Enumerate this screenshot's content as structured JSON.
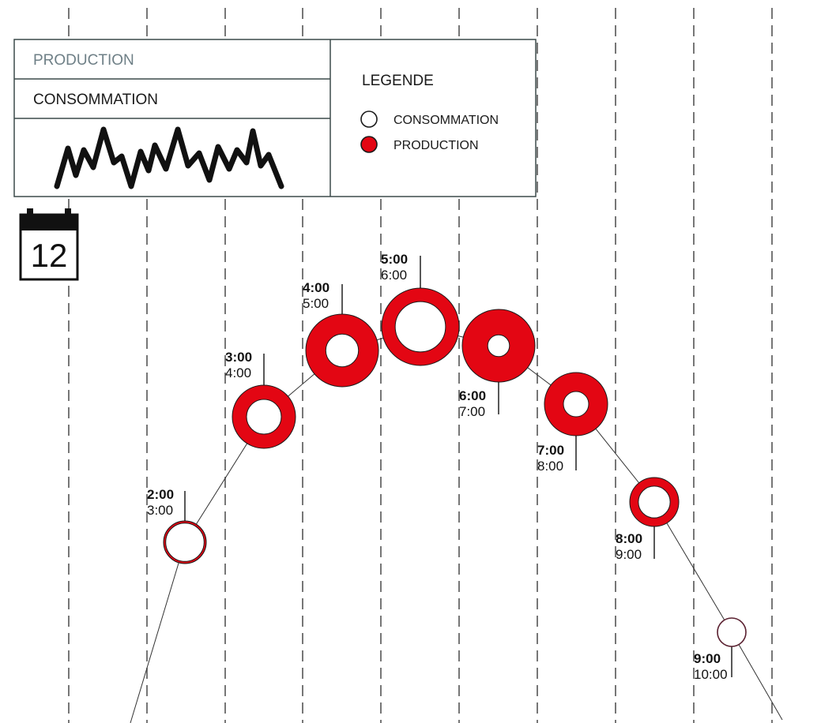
{
  "header": {
    "tab_production": "PRODUCTION",
    "tab_consommation": "CONSOMMATION"
  },
  "legend": {
    "title": "LEGENDE",
    "items": [
      {
        "label": "CONSOMMATION",
        "style": "outline"
      },
      {
        "label": "PRODUCTION",
        "style": "filled"
      }
    ]
  },
  "calendar": {
    "day": "12",
    "icon": "calendar-icon"
  },
  "colors": {
    "production": "#e30613",
    "outline": "#1a1a1a",
    "last_point": "#5a2030",
    "grid": "#555555"
  },
  "chart_data": {
    "type": "scatter",
    "title": "",
    "xlabel": "",
    "ylabel": "",
    "description_note_free": true,
    "grid": true,
    "points": [
      {
        "label_bold": "2:00",
        "label": "3:00",
        "production": 0.1,
        "consommation": 1.0
      },
      {
        "label_bold": "3:00",
        "label": "4:00",
        "production": 0.45,
        "consommation": 1.0
      },
      {
        "label_bold": "4:00",
        "label": "5:00",
        "production": 0.55,
        "consommation": 1.0
      },
      {
        "label_bold": "5:00",
        "label": "6:00",
        "production": 0.35,
        "consommation": 1.0
      },
      {
        "label_bold": "6:00",
        "label": "7:00",
        "production": 0.7,
        "consommation": 1.0
      },
      {
        "label_bold": "7:00",
        "label": "8:00",
        "production": 0.6,
        "consommation": 1.0
      },
      {
        "label_bold": "8:00",
        "label": "9:00",
        "production": 0.35,
        "consommation": 1.0
      },
      {
        "label_bold": "9:00",
        "label": "10:00",
        "production": 0.02,
        "consommation": 1.0
      }
    ]
  }
}
